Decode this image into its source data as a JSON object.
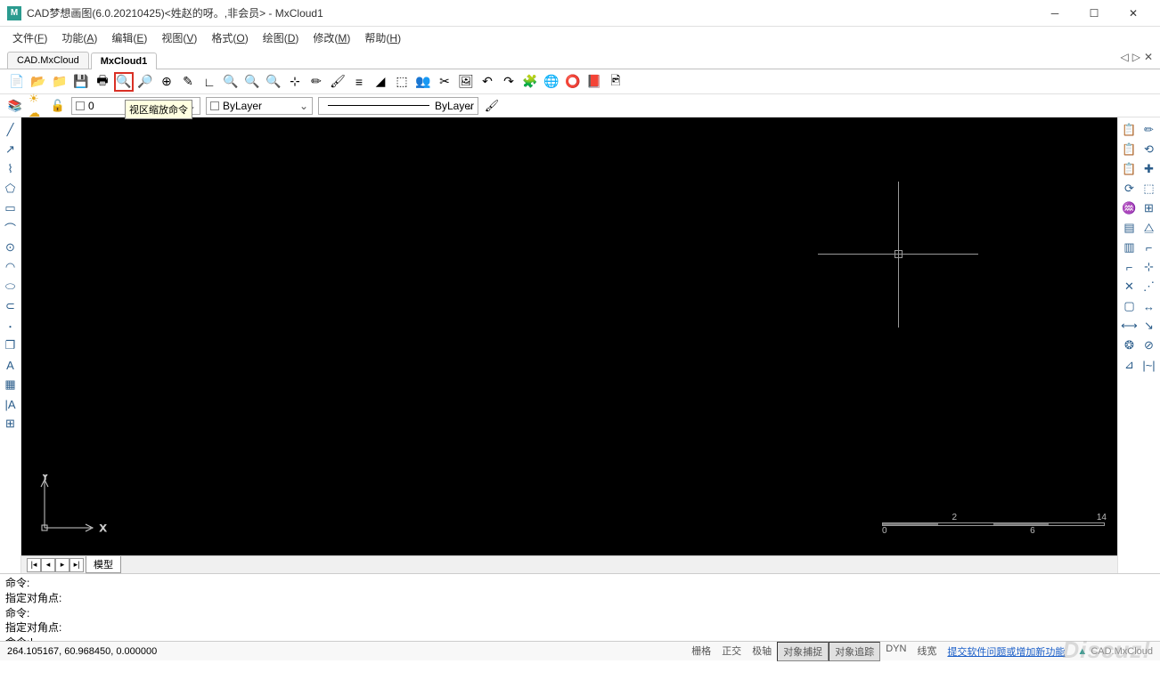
{
  "window": {
    "title": "CAD梦想画图(6.0.20210425)<姓赵的呀。,非会员> - MxCloud1",
    "logo": "M"
  },
  "menu": [
    {
      "label": "文件",
      "key": "F"
    },
    {
      "label": "功能",
      "key": "A"
    },
    {
      "label": "编辑",
      "key": "E"
    },
    {
      "label": "视图",
      "key": "V"
    },
    {
      "label": "格式",
      "key": "O"
    },
    {
      "label": "绘图",
      "key": "D"
    },
    {
      "label": "修改",
      "key": "M"
    },
    {
      "label": "帮助",
      "key": "H"
    }
  ],
  "tabs": [
    {
      "label": "CAD.MxCloud",
      "active": false
    },
    {
      "label": "MxCloud1",
      "active": true
    }
  ],
  "tooltip": "视区缩放命令",
  "layerbar": {
    "value": "0",
    "color": "ByLayer",
    "linetype": "ByLayer"
  },
  "bottom_tab": "模型",
  "command_lines": [
    "命令:",
    "指定对角点:",
    "命令:",
    "指定对角点:",
    "命令:"
  ],
  "status": {
    "coords": "264.105167,  60.968450,  0.000000",
    "modes": [
      {
        "label": "栅格",
        "on": false
      },
      {
        "label": "正交",
        "on": false
      },
      {
        "label": "极轴",
        "on": false
      },
      {
        "label": "对象捕捉",
        "on": true
      },
      {
        "label": "对象追踪",
        "on": true
      },
      {
        "label": "DYN",
        "on": false
      },
      {
        "label": "线宽",
        "on": false
      }
    ],
    "link": "提交软件问题或增加新功能",
    "brand": "CAD.MxCloud"
  },
  "ucs": {
    "x": "X",
    "y": "Y"
  },
  "scale": {
    "l": "0",
    "m1": "2",
    "m2": "6",
    "r": "14"
  },
  "watermark": "Discuz!",
  "toolbar_icons": [
    "📄",
    "📂",
    "📁",
    "💾",
    "🖶",
    "🔍",
    "🔎",
    "⊕",
    "✎",
    "∟",
    "🔍",
    "🔍",
    "🔍",
    "⊹",
    "✏",
    "🖌",
    "≡",
    "◢",
    "⬚",
    "👥",
    "✂",
    "🖼",
    "↶",
    "↷",
    "🧩",
    "🌐",
    "⭕",
    "📕",
    "🖻"
  ],
  "left_icons": [
    "╱",
    "↗",
    "⌇",
    "⬠",
    "▭",
    "⌒",
    "⊙",
    "◠",
    "⬭",
    "⊂",
    "･",
    "❐",
    "A",
    "▦",
    "|A",
    "⊞"
  ],
  "right_icons": [
    "📋",
    "✏",
    "📋",
    "⟲",
    "📋",
    "✚",
    "⟳",
    "⬚",
    "♒",
    "⊞",
    "▤",
    "⧋",
    "▥",
    "⌐",
    "⌐",
    "⊹",
    "✕",
    "⋰",
    "▢",
    "↔",
    "⟷",
    "↘",
    "❂",
    "⊘",
    "⊿",
    "|~|"
  ]
}
